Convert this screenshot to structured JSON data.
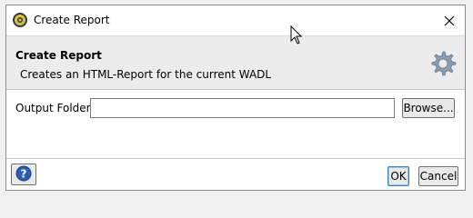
{
  "window": {
    "title": "Create Report"
  },
  "header": {
    "title": "Create Report",
    "description": "Creates an HTML-Report for the current WADL"
  },
  "form": {
    "output_folder_label": "Output Folder:",
    "output_folder_value": "",
    "browse_label": "Browse..."
  },
  "footer": {
    "ok_label": "OK",
    "cancel_label": "Cancel",
    "help_icon": "question-mark-icon"
  },
  "colors": {
    "header_bg": "#ececec",
    "help_blue": "#2a5db0",
    "ok_border": "#3c7fb1"
  }
}
